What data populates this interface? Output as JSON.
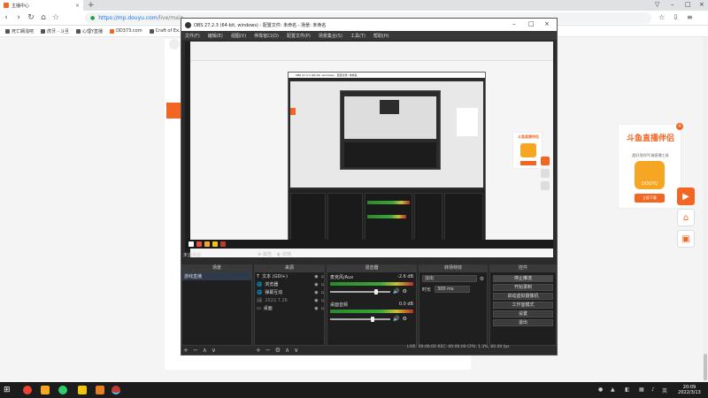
{
  "browser": {
    "tab_title": "主播中心",
    "url_host": "https://mp.douyu.com",
    "url_path": "/live/main",
    "bookmarks": [
      "死亡搁浅吧",
      "虎牙 - 斗旦",
      "心理Y直播",
      "DD373.com",
      "Craft of Ex..."
    ]
  },
  "page": {
    "promo_title": "斗鱼直播伴侣",
    "promo_subtitle": "超好用的PC端直播工具",
    "promo_logo_text": "DOUYU",
    "promo_button": "立即下载",
    "promo_close": "×"
  },
  "obs": {
    "title": "OBS 27.2.3 (64-bit, windows) - 配置文件: 未命名 - 场景: 未命名",
    "menu": [
      "文件(F)",
      "编辑(E)",
      "视图(V)",
      "停靠窗口(D)",
      "配置文件(P)",
      "场景集合(S)",
      "工具(T)",
      "帮助(H)"
    ],
    "scene_label": "未选择源",
    "scene_tabs": [
      "属性",
      "滤镜"
    ],
    "dock_headers": [
      "场景",
      "来源",
      "混音器",
      "转场特效",
      "控件"
    ],
    "scenes": [
      "游戏直播"
    ],
    "sources": [
      {
        "icon": "T",
        "name": "文本 (GDI+)"
      },
      {
        "icon": "🌐",
        "name": "浏览器"
      },
      {
        "icon": "🌐",
        "name": "弹幕互动"
      },
      {
        "icon": "🖼",
        "name": "2022.7.26"
      },
      {
        "icon": "▭",
        "name": "桌面"
      }
    ],
    "mixer": [
      {
        "name": "麦克风/Aux",
        "db": "-2.6 dB",
        "level": 0.78
      },
      {
        "name": "桌面音频",
        "db": "0.0 dB",
        "level": 0.72
      }
    ],
    "transition": {
      "type": "淡出",
      "duration_label": "时长",
      "duration": "300 ms"
    },
    "controls": [
      "停止推流",
      "开始录制",
      "启动虚拟摄像机",
      "工作室模式",
      "设置",
      "退出"
    ],
    "status": "LIVE: 00:00:00   REC: 00:00:00   CPU: 1.3%, 60.00 fps",
    "nested_title": "OBS 27.2.3 (64-bit, windows) - 配置文件: 未命名"
  },
  "taskbar": {
    "time": "20:09",
    "date": "2022/3/13"
  },
  "colors": {
    "douyu_orange": "#f26522",
    "obs_bg": "#2b2b2b"
  }
}
